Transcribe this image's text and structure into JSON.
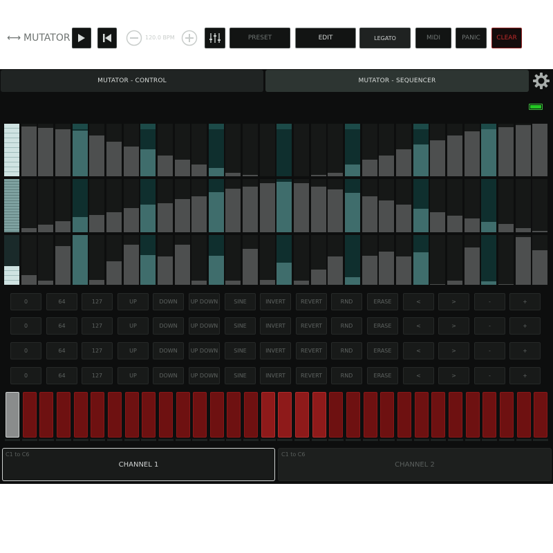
{
  "tabs": {
    "control": "MUTATOR - CONTROL",
    "sequencer": "MUTATOR - SEQUENCER"
  },
  "toolbar": {
    "title": "MUTATOR",
    "bpm": "120.0 BPM",
    "preset": "PRESET",
    "edit": "EDIT",
    "legato": "LEGATO",
    "midi": "MIDI",
    "panic": "PANIC",
    "clear": "CLEAR",
    "battery_color": "#22c722"
  },
  "sequencer": {
    "steps": 32,
    "selected_step": 0,
    "highlighted_steps": [
      4,
      8,
      12,
      16,
      20,
      24,
      28
    ],
    "lanes": [
      [
        1.0,
        0.95,
        0.92,
        0.9,
        0.87,
        0.77,
        0.66,
        0.57,
        0.51,
        0.4,
        0.31,
        0.23,
        0.16,
        0.07,
        0.03,
        0.0,
        0.0,
        0.0,
        0.03,
        0.07,
        0.22,
        0.31,
        0.4,
        0.51,
        0.6,
        0.68,
        0.77,
        0.86,
        0.9,
        0.93,
        0.97,
        1.0
      ],
      [
        1.0,
        0.08,
        0.14,
        0.21,
        0.28,
        0.32,
        0.38,
        0.45,
        0.52,
        0.55,
        0.62,
        0.68,
        0.75,
        0.82,
        0.86,
        0.92,
        0.95,
        0.92,
        0.86,
        0.81,
        0.74,
        0.67,
        0.6,
        0.52,
        0.44,
        0.38,
        0.31,
        0.26,
        0.2,
        0.16,
        0.08,
        0.02
      ],
      [
        0.38,
        0.2,
        0.08,
        0.78,
        1.0,
        0.1,
        0.47,
        0.8,
        0.6,
        0.57,
        0.81,
        0.08,
        0.58,
        0.08,
        0.72,
        0.1,
        0.45,
        0.09,
        0.3,
        0.57,
        0.15,
        0.58,
        0.67,
        0.57,
        0.65,
        0.02,
        0.09,
        0.75,
        0.07,
        0.01,
        0.96,
        0.69
      ]
    ]
  },
  "function_rows": [
    [
      "0",
      "64",
      "127",
      "UP",
      "DOWN",
      "UP DOWN",
      "SINE",
      "INVERT",
      "REVERT",
      "RND",
      "ERASE",
      "<",
      ">",
      "-",
      "+"
    ],
    [
      "0",
      "64",
      "127",
      "UP",
      "DOWN",
      "UP DOWN",
      "SINE",
      "INVERT",
      "REVERT",
      "RND",
      "ERASE",
      "<",
      ">",
      "-",
      "+"
    ],
    [
      "0",
      "64",
      "127",
      "UP",
      "DOWN",
      "UP DOWN",
      "SINE",
      "INVERT",
      "REVERT",
      "RND",
      "ERASE",
      "<",
      ">",
      "-",
      "+"
    ],
    [
      "0",
      "64",
      "127",
      "UP",
      "DOWN",
      "UP DOWN",
      "SINE",
      "INVERT",
      "REVERT",
      "RND",
      "ERASE",
      "<",
      ">",
      "-",
      "+"
    ]
  ],
  "gates": {
    "count": 32,
    "active_step": 0,
    "bright_steps": [
      15,
      16,
      17,
      18
    ]
  },
  "channels": [
    {
      "range": "C1 to C6",
      "name": "CHANNEL 1",
      "selected": true
    },
    {
      "range": "C1 to C6",
      "name": "CHANNEL 2",
      "selected": false
    }
  ]
}
